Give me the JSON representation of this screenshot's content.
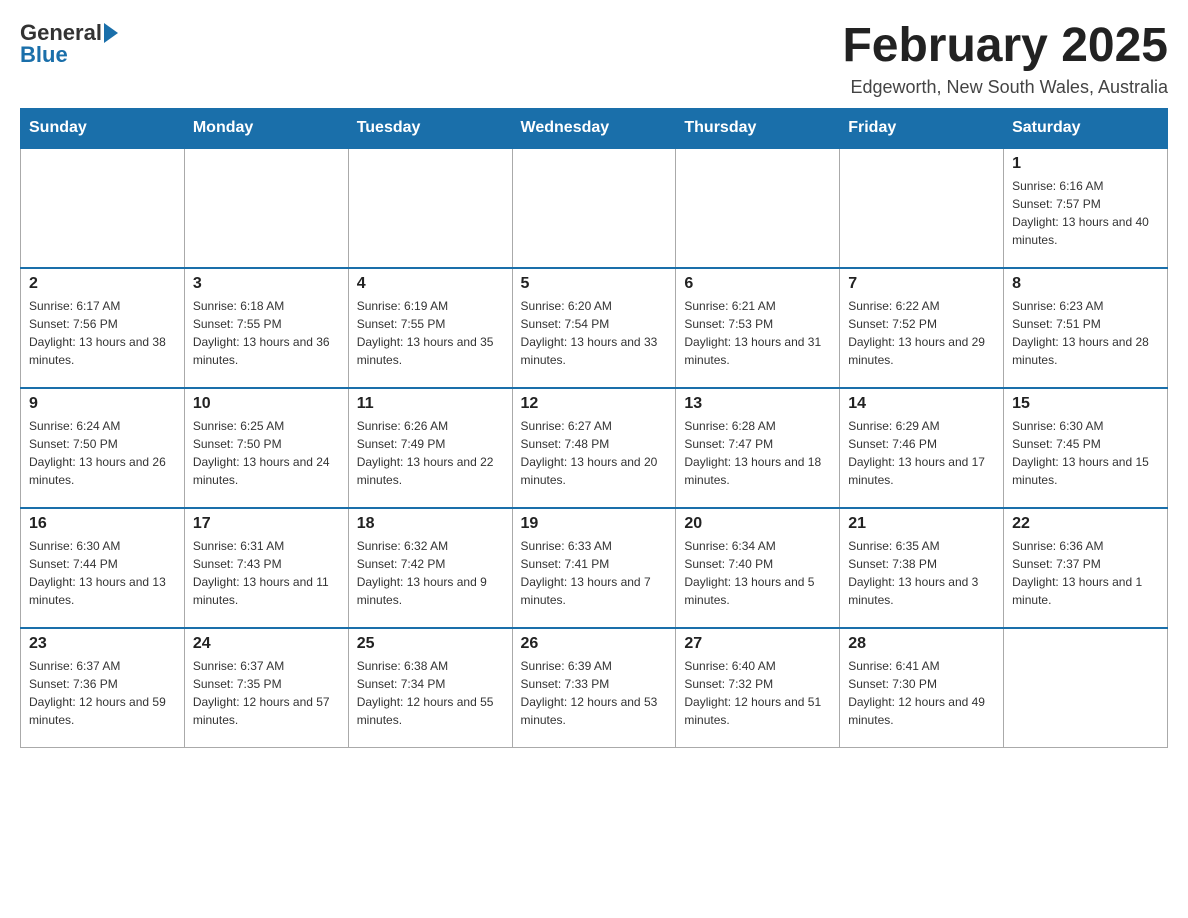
{
  "logo": {
    "general": "General",
    "blue": "Blue"
  },
  "title": "February 2025",
  "location": "Edgeworth, New South Wales, Australia",
  "days_of_week": [
    "Sunday",
    "Monday",
    "Tuesday",
    "Wednesday",
    "Thursday",
    "Friday",
    "Saturday"
  ],
  "weeks": [
    [
      {
        "day": "",
        "info": ""
      },
      {
        "day": "",
        "info": ""
      },
      {
        "day": "",
        "info": ""
      },
      {
        "day": "",
        "info": ""
      },
      {
        "day": "",
        "info": ""
      },
      {
        "day": "",
        "info": ""
      },
      {
        "day": "1",
        "info": "Sunrise: 6:16 AM\nSunset: 7:57 PM\nDaylight: 13 hours and 40 minutes."
      }
    ],
    [
      {
        "day": "2",
        "info": "Sunrise: 6:17 AM\nSunset: 7:56 PM\nDaylight: 13 hours and 38 minutes."
      },
      {
        "day": "3",
        "info": "Sunrise: 6:18 AM\nSunset: 7:55 PM\nDaylight: 13 hours and 36 minutes."
      },
      {
        "day": "4",
        "info": "Sunrise: 6:19 AM\nSunset: 7:55 PM\nDaylight: 13 hours and 35 minutes."
      },
      {
        "day": "5",
        "info": "Sunrise: 6:20 AM\nSunset: 7:54 PM\nDaylight: 13 hours and 33 minutes."
      },
      {
        "day": "6",
        "info": "Sunrise: 6:21 AM\nSunset: 7:53 PM\nDaylight: 13 hours and 31 minutes."
      },
      {
        "day": "7",
        "info": "Sunrise: 6:22 AM\nSunset: 7:52 PM\nDaylight: 13 hours and 29 minutes."
      },
      {
        "day": "8",
        "info": "Sunrise: 6:23 AM\nSunset: 7:51 PM\nDaylight: 13 hours and 28 minutes."
      }
    ],
    [
      {
        "day": "9",
        "info": "Sunrise: 6:24 AM\nSunset: 7:50 PM\nDaylight: 13 hours and 26 minutes."
      },
      {
        "day": "10",
        "info": "Sunrise: 6:25 AM\nSunset: 7:50 PM\nDaylight: 13 hours and 24 minutes."
      },
      {
        "day": "11",
        "info": "Sunrise: 6:26 AM\nSunset: 7:49 PM\nDaylight: 13 hours and 22 minutes."
      },
      {
        "day": "12",
        "info": "Sunrise: 6:27 AM\nSunset: 7:48 PM\nDaylight: 13 hours and 20 minutes."
      },
      {
        "day": "13",
        "info": "Sunrise: 6:28 AM\nSunset: 7:47 PM\nDaylight: 13 hours and 18 minutes."
      },
      {
        "day": "14",
        "info": "Sunrise: 6:29 AM\nSunset: 7:46 PM\nDaylight: 13 hours and 17 minutes."
      },
      {
        "day": "15",
        "info": "Sunrise: 6:30 AM\nSunset: 7:45 PM\nDaylight: 13 hours and 15 minutes."
      }
    ],
    [
      {
        "day": "16",
        "info": "Sunrise: 6:30 AM\nSunset: 7:44 PM\nDaylight: 13 hours and 13 minutes."
      },
      {
        "day": "17",
        "info": "Sunrise: 6:31 AM\nSunset: 7:43 PM\nDaylight: 13 hours and 11 minutes."
      },
      {
        "day": "18",
        "info": "Sunrise: 6:32 AM\nSunset: 7:42 PM\nDaylight: 13 hours and 9 minutes."
      },
      {
        "day": "19",
        "info": "Sunrise: 6:33 AM\nSunset: 7:41 PM\nDaylight: 13 hours and 7 minutes."
      },
      {
        "day": "20",
        "info": "Sunrise: 6:34 AM\nSunset: 7:40 PM\nDaylight: 13 hours and 5 minutes."
      },
      {
        "day": "21",
        "info": "Sunrise: 6:35 AM\nSunset: 7:38 PM\nDaylight: 13 hours and 3 minutes."
      },
      {
        "day": "22",
        "info": "Sunrise: 6:36 AM\nSunset: 7:37 PM\nDaylight: 13 hours and 1 minute."
      }
    ],
    [
      {
        "day": "23",
        "info": "Sunrise: 6:37 AM\nSunset: 7:36 PM\nDaylight: 12 hours and 59 minutes."
      },
      {
        "day": "24",
        "info": "Sunrise: 6:37 AM\nSunset: 7:35 PM\nDaylight: 12 hours and 57 minutes."
      },
      {
        "day": "25",
        "info": "Sunrise: 6:38 AM\nSunset: 7:34 PM\nDaylight: 12 hours and 55 minutes."
      },
      {
        "day": "26",
        "info": "Sunrise: 6:39 AM\nSunset: 7:33 PM\nDaylight: 12 hours and 53 minutes."
      },
      {
        "day": "27",
        "info": "Sunrise: 6:40 AM\nSunset: 7:32 PM\nDaylight: 12 hours and 51 minutes."
      },
      {
        "day": "28",
        "info": "Sunrise: 6:41 AM\nSunset: 7:30 PM\nDaylight: 12 hours and 49 minutes."
      },
      {
        "day": "",
        "info": ""
      }
    ]
  ]
}
